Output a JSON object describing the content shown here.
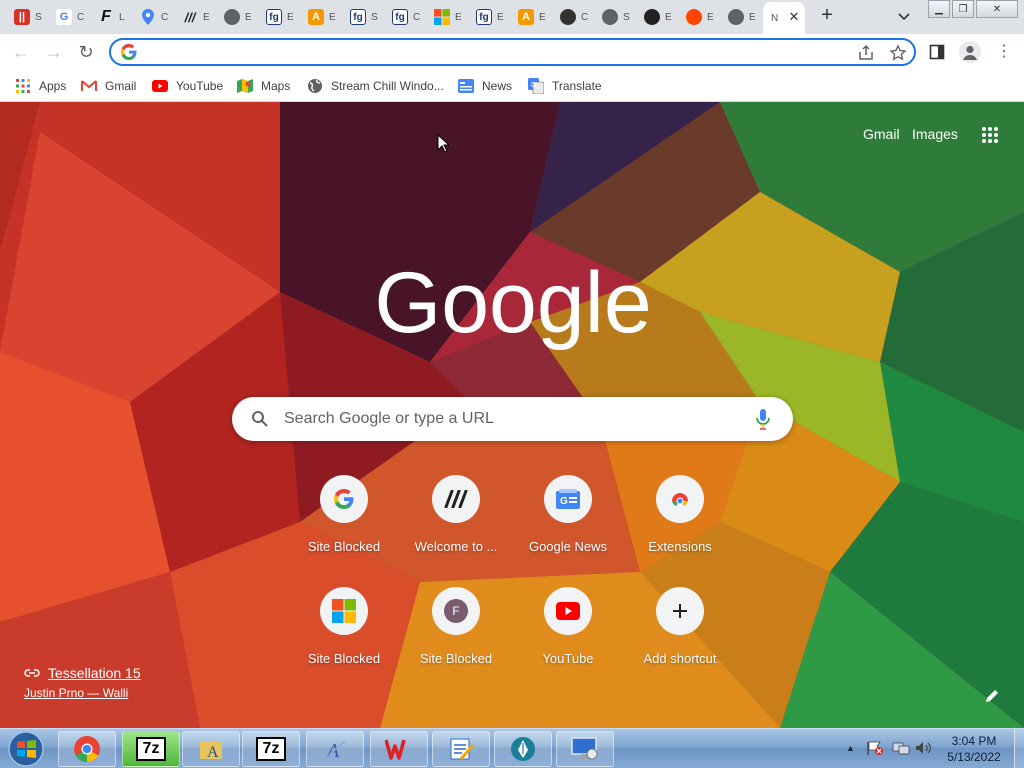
{
  "tabs": [
    {
      "icon": "red-ii-icon",
      "title": "S"
    },
    {
      "icon": "google-g-icon",
      "title": "C"
    },
    {
      "icon": "f-logo-icon",
      "title": "L"
    },
    {
      "icon": "maps-pin-icon",
      "title": "C"
    },
    {
      "icon": "slash-logo-icon",
      "title": "E"
    },
    {
      "icon": "globe-icon",
      "title": "E"
    },
    {
      "icon": "fg-icon",
      "title": "E"
    },
    {
      "icon": "orange-a-icon",
      "title": "E"
    },
    {
      "icon": "fg-icon",
      "title": "S"
    },
    {
      "icon": "fg-icon",
      "title": "C"
    },
    {
      "icon": "microsoft-icon",
      "title": "E"
    },
    {
      "icon": "fg-icon",
      "title": "E"
    },
    {
      "icon": "orange-a-icon",
      "title": "E"
    },
    {
      "icon": "skull-icon",
      "title": "C"
    },
    {
      "icon": "globe-icon",
      "title": "S"
    },
    {
      "icon": "github-icon",
      "title": "E"
    },
    {
      "icon": "reddit-icon",
      "title": "E"
    },
    {
      "icon": "globe-icon",
      "title": "E"
    },
    {
      "icon": "new-tab-icon",
      "title": "N",
      "active": true
    }
  ],
  "toolbar": {
    "omnibox_value": ""
  },
  "bookmarks": [
    {
      "label": "Apps",
      "icon": "apps-grid-icon"
    },
    {
      "label": "Gmail",
      "icon": "gmail-icon"
    },
    {
      "label": "YouTube",
      "icon": "youtube-icon"
    },
    {
      "label": "Maps",
      "icon": "maps-icon"
    },
    {
      "label": "Stream Chill Windo...",
      "icon": "globe-icon"
    },
    {
      "label": "News",
      "icon": "google-news-icon"
    },
    {
      "label": "Translate",
      "icon": "translate-icon"
    }
  ],
  "ntp": {
    "gmail_link": "Gmail",
    "images_link": "Images",
    "logo_text": "Google",
    "search_placeholder": "Search Google or type a URL",
    "shortcuts": [
      {
        "label": "Site Blocked",
        "icon": "google-g-icon"
      },
      {
        "label": "Welcome to ...",
        "icon": "slash-logo-icon"
      },
      {
        "label": "Google News",
        "icon": "google-news-icon"
      },
      {
        "label": "Extensions",
        "icon": "chrome-icon"
      },
      {
        "label": "Site Blocked",
        "icon": "microsoft-icon"
      },
      {
        "label": "Site Blocked",
        "icon": "letter-f-icon"
      },
      {
        "label": "YouTube",
        "icon": "youtube-icon"
      },
      {
        "label": "Add shortcut",
        "icon": "plus-icon"
      }
    ],
    "attribution_title": "Tessellation 15",
    "attribution_author": "Justin Prno — Walli"
  },
  "taskbar": {
    "time": "3:04 PM",
    "date": "5/13/2022",
    "apps": [
      "chrome-icon",
      "7zip-icon",
      "folder-a-icon",
      "7zip-icon",
      "pen-a-icon",
      "wps-icon",
      "notes-icon",
      "pen-nib-icon",
      "monitor-icon"
    ]
  },
  "colors": {
    "accent": "#1a73e8",
    "tab_bg": "#dee1e6"
  }
}
